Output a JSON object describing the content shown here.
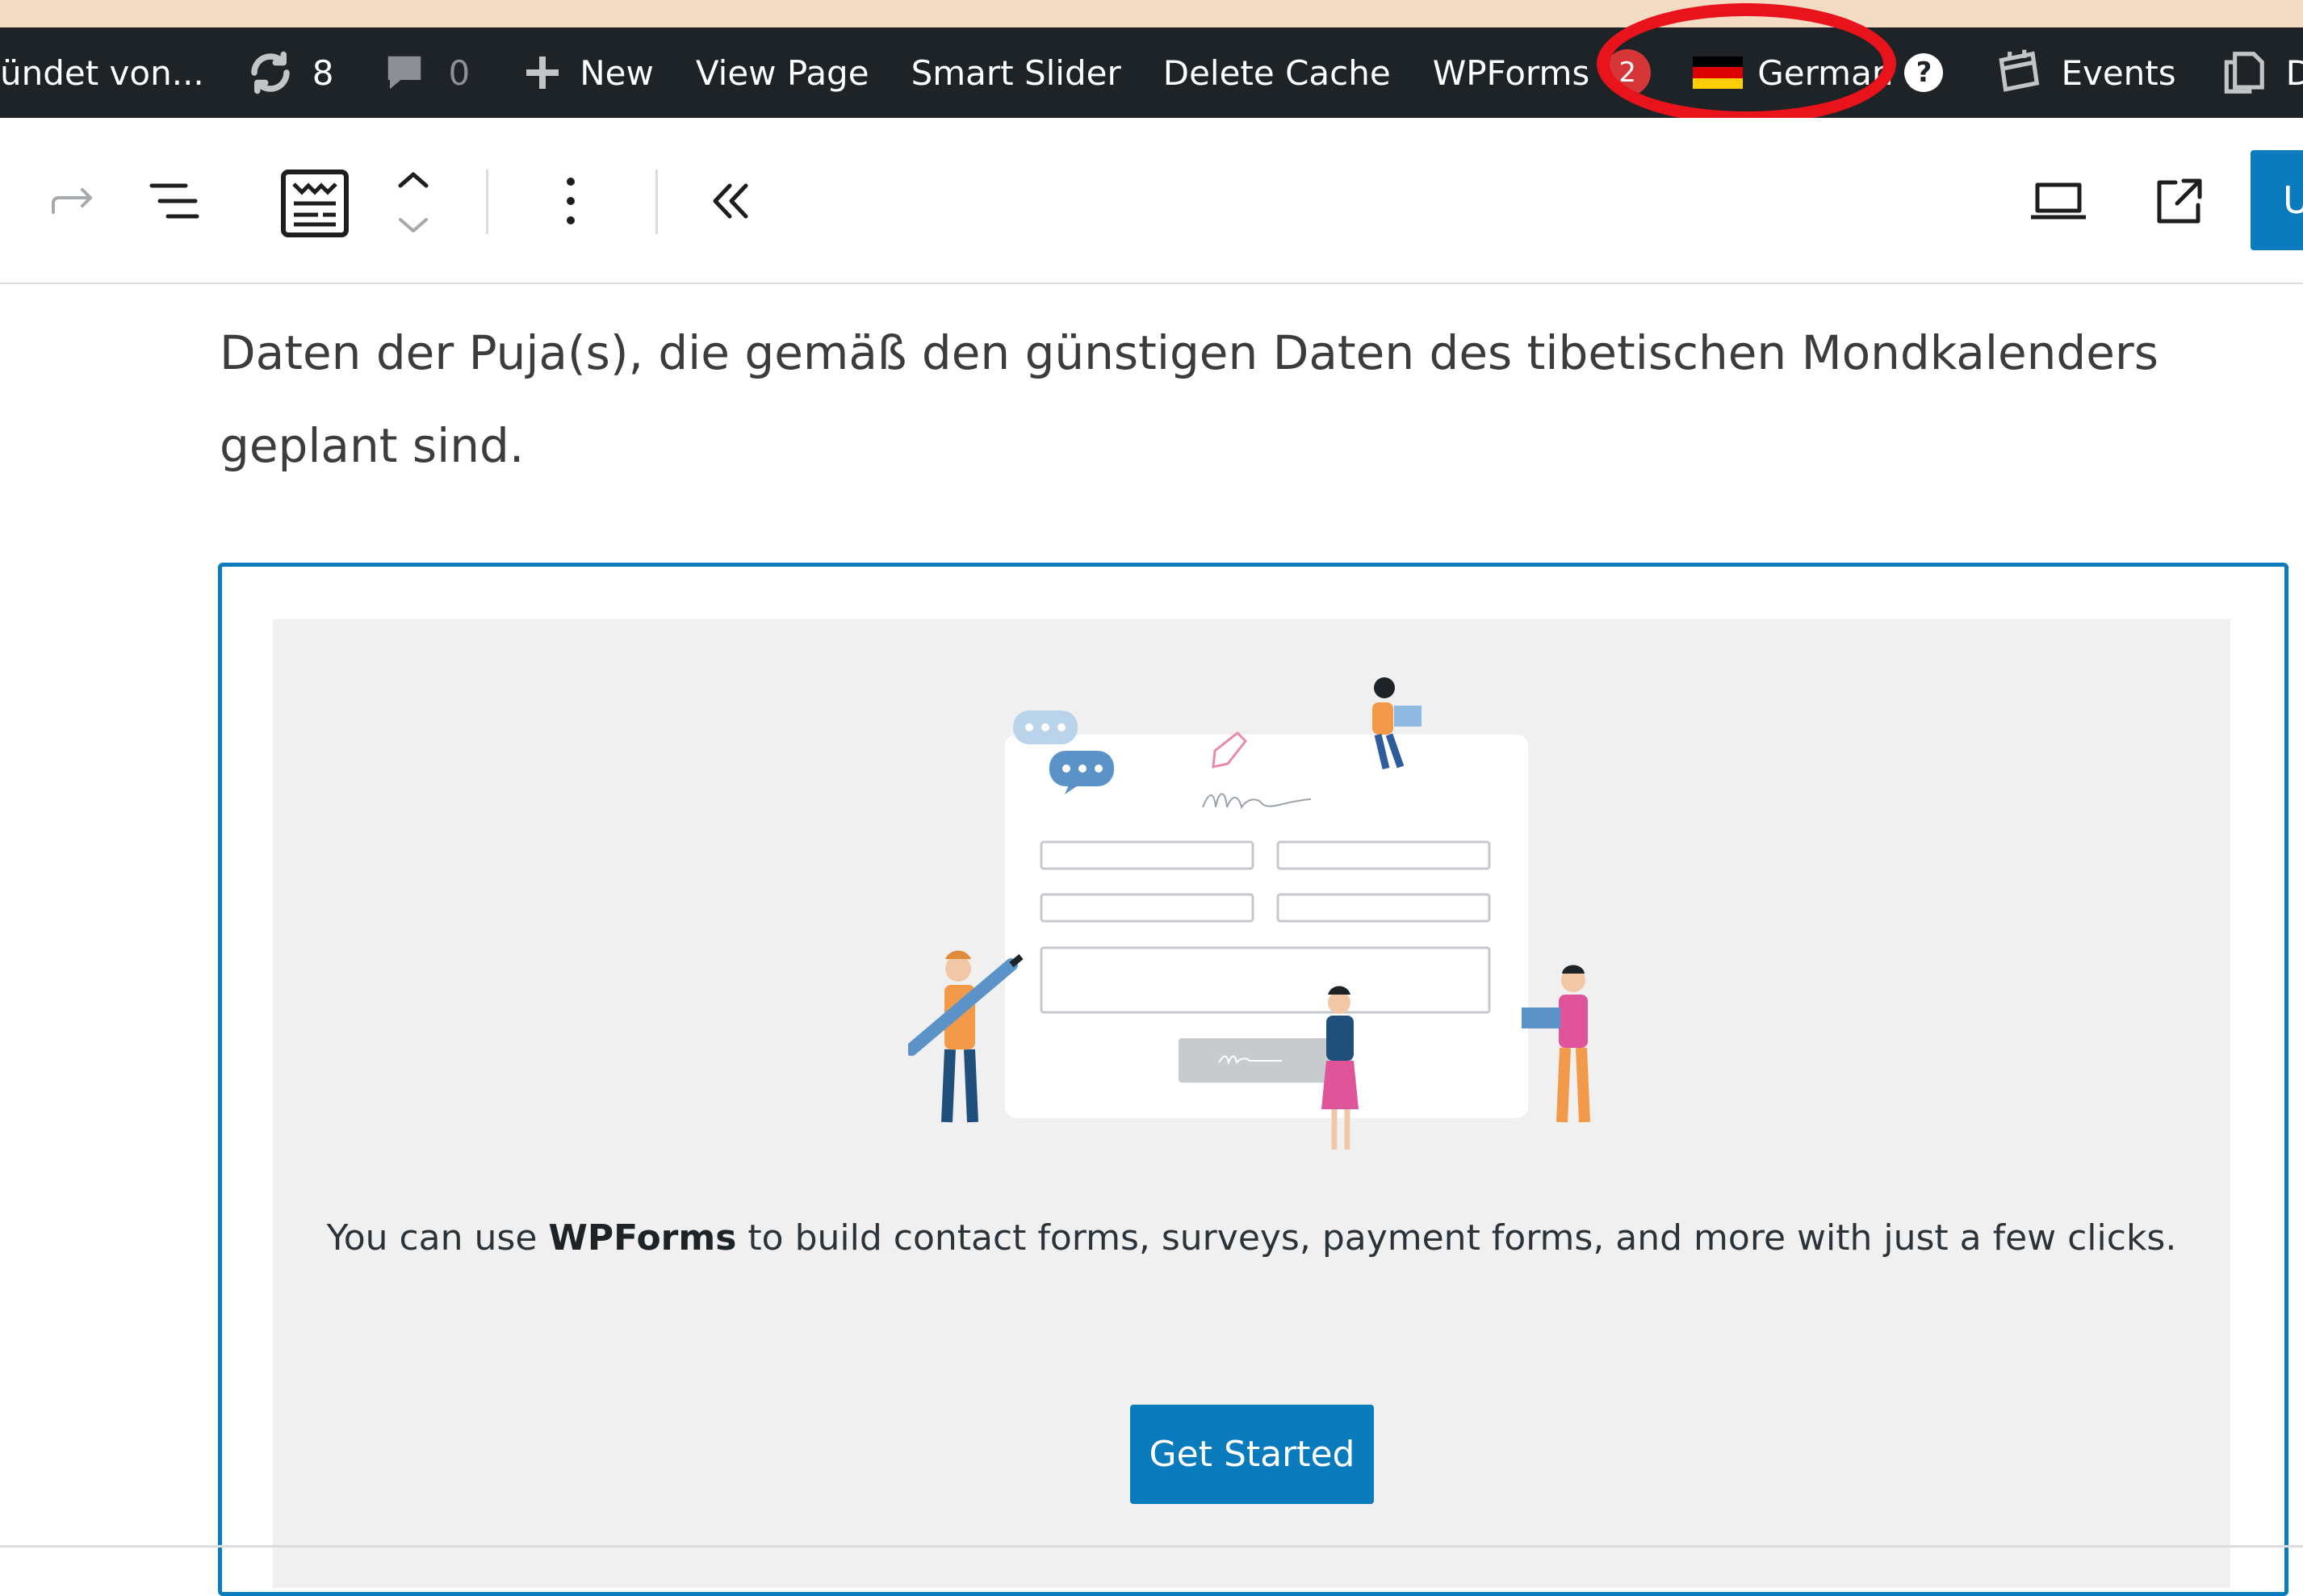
{
  "admin_bar": {
    "site_name": "ündet von...",
    "updates_count": "8",
    "comments_count": "0",
    "new_label": "New",
    "view_page_label": "View Page",
    "smart_slider_label": "Smart Slider",
    "delete_cache_label": "Delete Cache",
    "wpforms_label": "WPForms",
    "wpforms_badge": "2",
    "language_label": "German",
    "language_help": "?",
    "events_label": "Events",
    "duplicate_label": "Duplic"
  },
  "toolbar": {
    "icons": [
      "redo-icon",
      "document-overview-icon",
      "wpforms-block-icon",
      "move-up-down-icon",
      "more-options-icon",
      "collapse-sidebar-icon",
      "preview-icon",
      "view-post-icon"
    ],
    "update_label": "U"
  },
  "content": {
    "paragraph": "Daten der Puja(s), die gemäß den günstigen Daten des tibetischen Mondkalenders geplant sind.",
    "description_before": "You can use ",
    "description_brand": "WPForms",
    "description_after": " to build contact forms, surveys, payment forms, and more with just a few clicks.",
    "get_started_label": "Get Started"
  },
  "colors": {
    "admin_bar_bg": "#1d2327",
    "accent_blue": "#0a7bbd",
    "badge_red": "#d63638",
    "highlight_red": "#e8131b",
    "placeholder_bg": "#f0f0f1"
  }
}
